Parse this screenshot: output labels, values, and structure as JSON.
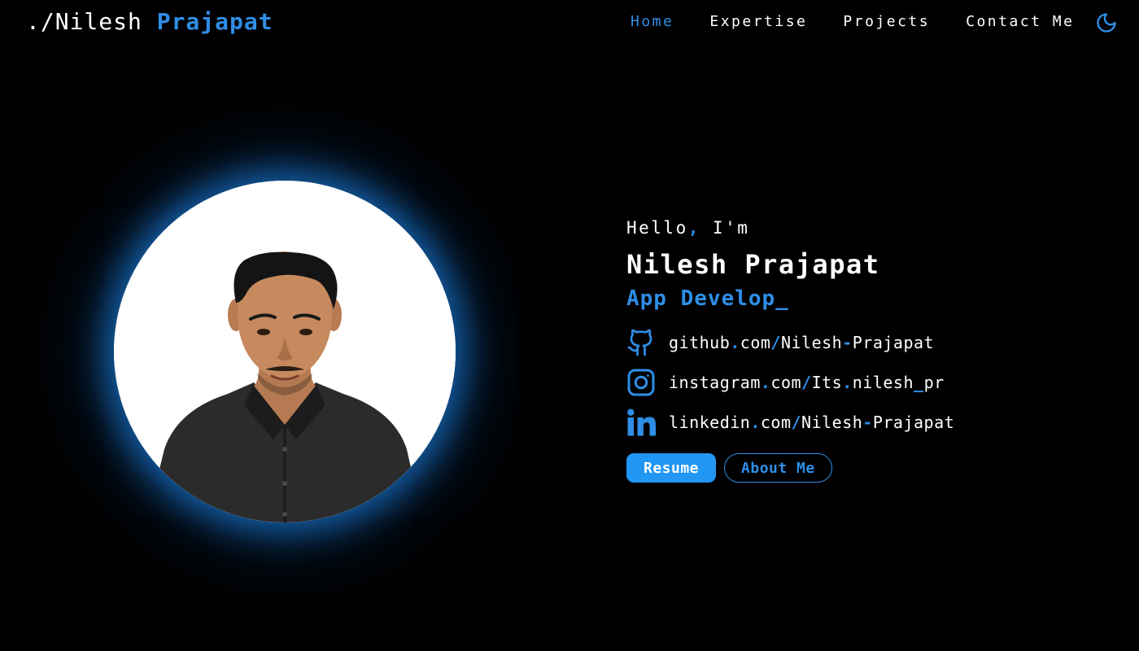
{
  "brand": {
    "prefix": "./Nilesh",
    "highlight": "Prajapat"
  },
  "nav": {
    "items": [
      {
        "label": "Home",
        "active": true
      },
      {
        "label": "Expertise",
        "active": false
      },
      {
        "label": "Projects",
        "active": false
      },
      {
        "label": "Contact Me",
        "active": false
      }
    ],
    "theme_icon": "moon-icon"
  },
  "hero": {
    "greeting": {
      "before": "Hello",
      "comma": ",",
      "after": " I'm"
    },
    "name": "Nilesh Prajapat",
    "role": "App Develop_",
    "socials": [
      {
        "icon": "github-icon",
        "parts": [
          "github",
          ".",
          "com",
          "/",
          "Nilesh",
          "-",
          "Prajapat"
        ]
      },
      {
        "icon": "instagram-icon",
        "parts": [
          "instagram",
          ".",
          "com",
          "/",
          "Its",
          ".",
          "nilesh",
          "_",
          "pr"
        ]
      },
      {
        "icon": "linkedin-icon",
        "parts": [
          "linkedin",
          ".",
          "com",
          "/",
          "Nilesh",
          "-",
          "Prajapat"
        ]
      }
    ],
    "buttons": {
      "resume": "Resume",
      "about": "About Me"
    }
  },
  "colors": {
    "accent": "#2f8ee6",
    "button_primary": "#2196f3",
    "background": "#000000",
    "text": "#ffffff"
  }
}
